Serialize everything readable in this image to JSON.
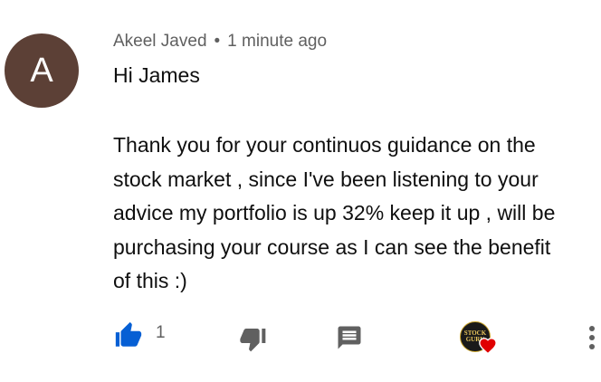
{
  "comment": {
    "avatar_letter": "A",
    "author": "Akeel Javed",
    "separator": "•",
    "timestamp": "1 minute ago",
    "greeting": "Hi James",
    "body": "Thank you for your continuos guidance on the\nstock market , since I've been listening to your\nadvice my portfolio is up 32% keep it up , will be\npurchasing your course as I can see the  benefit\nof this :)"
  },
  "actions": {
    "like_count": "1",
    "creator_badge_line1": "STOCK",
    "creator_badge_line2": "GURU"
  },
  "icons": {
    "like": "thumbs-up-icon",
    "dislike": "thumbs-down-icon",
    "reply": "comment-icon",
    "heart": "heart-icon",
    "menu": "more-vertical-icon"
  },
  "colors": {
    "avatar_bg": "#5c4036",
    "like_blue": "#065fd4",
    "icon_gray": "#606060",
    "heart_red": "#e00000"
  }
}
